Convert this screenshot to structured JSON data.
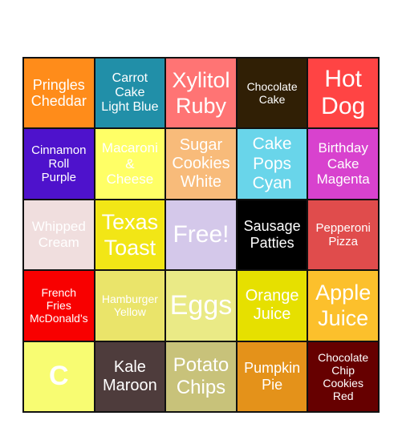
{
  "board": {
    "cells": [
      {
        "text": "Pringles\nCheddar",
        "color": "#FF8C1A"
      },
      {
        "text": "Carrot\nCake\nLight Blue",
        "color": "#218FA8"
      },
      {
        "text": "Xylitol\nRuby",
        "color": "#FF7474"
      },
      {
        "text": "Chocolate\nCake",
        "color": "#301F05"
      },
      {
        "text": "Hot\nDog",
        "color": "#FF4444"
      },
      {
        "text": "Cinnamon\nRoll\nPurple",
        "color": "#4E12CC"
      },
      {
        "text": "Macaroni\n&\nCheese",
        "color": "#FFFF66"
      },
      {
        "text": "Sugar\nCookies\nWhite",
        "color": "#F8BB7A"
      },
      {
        "text": "Cake\nPops\nCyan",
        "color": "#69D5EA"
      },
      {
        "text": "Birthday\nCake\nMagenta",
        "color": "#D842CE"
      },
      {
        "text": "Whipped\nCream",
        "color": "#F0DEDE"
      },
      {
        "text": "Texas\nToast",
        "color": "#F2E616"
      },
      {
        "text": "Free!",
        "color": "#D4C8EA"
      },
      {
        "text": "Sausage\nPatties",
        "color": "#000000"
      },
      {
        "text": "Pepperoni\nPizza",
        "color": "#E04C4C"
      },
      {
        "text": "French\nFries\nMcDonald's",
        "color": "#F80000"
      },
      {
        "text": "Hamburger\nYellow",
        "color": "#EAE46A"
      },
      {
        "text": "Eggs",
        "color": "#EAEA86"
      },
      {
        "text": "Orange\nJuice",
        "color": "#E6E000"
      },
      {
        "text": "Apple\nJuice",
        "color": "#FCC02C"
      },
      {
        "text": "C",
        "color": "#F8FC72"
      },
      {
        "text": "Kale\nMaroon",
        "color": "#4E3C3C"
      },
      {
        "text": "Potato\nChips",
        "color": "#C8C27A"
      },
      {
        "text": "Pumpkin\nPie",
        "color": "#E4921A"
      },
      {
        "text": "Chocolate\nChip\nCookies\nRed",
        "color": "#660000"
      }
    ]
  }
}
